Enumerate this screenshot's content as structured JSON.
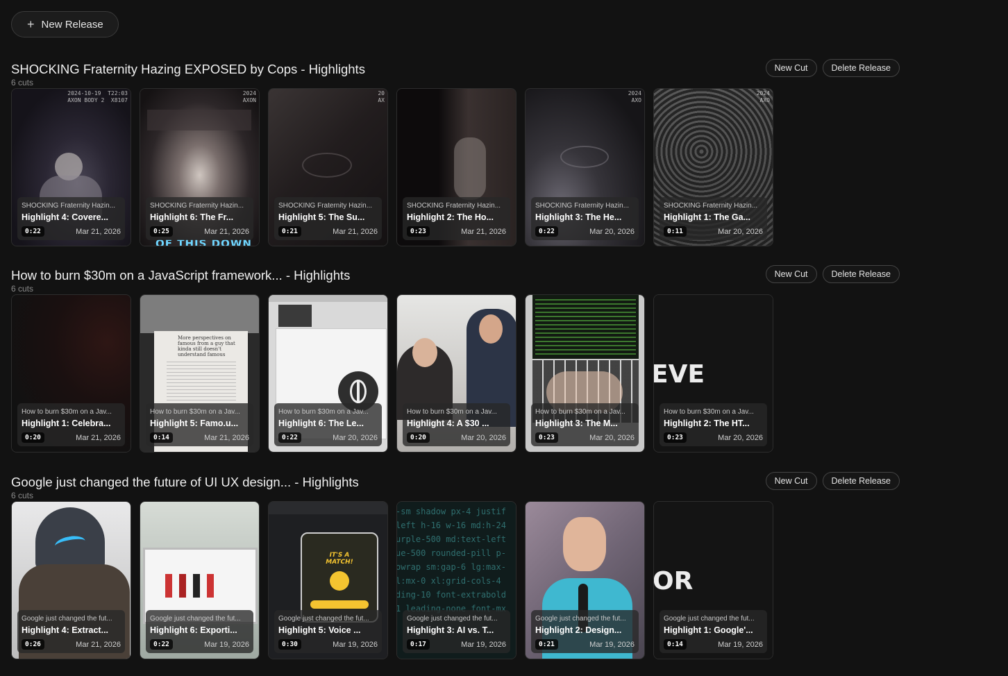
{
  "header": {
    "new_release_label": "New Release",
    "plus_icon": "plus-icon"
  },
  "actions": {
    "new_cut_label": "New Cut",
    "delete_release_label": "Delete Release"
  },
  "releases": [
    {
      "title": "SHOCKING Fraternity Hazing EXPOSED by Cops - Highlights",
      "count": "6 cuts",
      "cuts": [
        {
          "release": "SHOCKING Fraternity Hazin...",
          "title": "Highlight 4: Covere...",
          "duration": "0:22",
          "date": "Mar 21, 2026",
          "stamp": "2024-10-19  T22:03\nAXON BODY 2  X8107"
        },
        {
          "release": "SHOCKING Fraternity Hazin...",
          "title": "Highlight 6: The Fr...",
          "duration": "0:25",
          "date": "Mar 21, 2026",
          "stamp": "2024\nAXON",
          "caption": "OF THIS DOWN"
        },
        {
          "release": "SHOCKING Fraternity Hazin...",
          "title": "Highlight 5: The Su...",
          "duration": "0:21",
          "date": "Mar 21, 2026",
          "stamp": "20\nAX"
        },
        {
          "release": "SHOCKING Fraternity Hazin...",
          "title": "Highlight 2: The Ho...",
          "duration": "0:23",
          "date": "Mar 21, 2026",
          "stamp": ""
        },
        {
          "release": "SHOCKING Fraternity Hazin...",
          "title": "Highlight 3: The He...",
          "duration": "0:22",
          "date": "Mar 20, 2026",
          "stamp": "2024\nAXO"
        },
        {
          "release": "SHOCKING Fraternity Hazin...",
          "title": "Highlight 1: The Ga...",
          "duration": "0:11",
          "date": "Mar 20, 2026",
          "stamp": "2024\nAXO"
        }
      ]
    },
    {
      "title": "How to burn $30m on a JavaScript framework... - Highlights",
      "count": "6 cuts",
      "cuts": [
        {
          "release": "How to burn $30m on a Jav...",
          "title": "Highlight 1: Celebra...",
          "duration": "0:20",
          "date": "Mar 21, 2026"
        },
        {
          "release": "How to burn $30m on a Jav...",
          "title": "Highlight 5: Famo.u...",
          "duration": "0:14",
          "date": "Mar 21, 2026",
          "doc_heading": "More perspectives on famous from a guy that kinda still doesn't understand famous"
        },
        {
          "release": "How to burn $30m on a Jav...",
          "title": "Highlight 6: The Le...",
          "duration": "0:22",
          "date": "Mar 20, 2026"
        },
        {
          "release": "How to burn $30m on a Jav...",
          "title": "Highlight 4: A $30 ...",
          "duration": "0:20",
          "date": "Mar 20, 2026"
        },
        {
          "release": "How to burn $30m on a Jav...",
          "title": "Highlight 3: The M...",
          "duration": "0:23",
          "date": "Mar 20, 2026"
        },
        {
          "release": "How to burn $30m on a Jav...",
          "title": "Highlight 2: The HT...",
          "duration": "0:23",
          "date": "Mar 20, 2026",
          "big_word": "EVE"
        }
      ]
    },
    {
      "title": "Google just changed the future of UI UX design... - Highlights",
      "count": "6 cuts",
      "cuts": [
        {
          "release": "Google just changed the fut...",
          "title": "Highlight 4: Extract...",
          "duration": "0:26",
          "date": "Mar 21, 2026"
        },
        {
          "release": "Google just changed the fut...",
          "title": "Highlight 6: Exporti...",
          "duration": "0:22",
          "date": "Mar 19, 2026"
        },
        {
          "release": "Google just changed the fut...",
          "title": "Highlight 5: Voice ...",
          "duration": "0:30",
          "date": "Mar 19, 2026",
          "phone_text": "IT'S A MATCH!"
        },
        {
          "release": "Google just changed the fut...",
          "title": "Highlight 3: AI vs. T...",
          "duration": "0:17",
          "date": "Mar 19, 2026",
          "code": "-sm shadow px-4 justif\nleft h-16 w-16 md:h-24\nurple-500 md:text-left\nue-500 rounded-pill p-\nowrap sm:gap-6 lg:max-\nl:mx-0 xl:grid-cols-4\nding-10 font-extrabold\n1 leading-none font-mx"
        },
        {
          "release": "Google just changed the fut...",
          "title": "Highlight 2: Design...",
          "duration": "0:21",
          "date": "Mar 19, 2026"
        },
        {
          "release": "Google just changed the fut...",
          "title": "Highlight 1: Google'...",
          "duration": "0:14",
          "date": "Mar 19, 2026",
          "big_word": "OR"
        }
      ]
    }
  ]
}
